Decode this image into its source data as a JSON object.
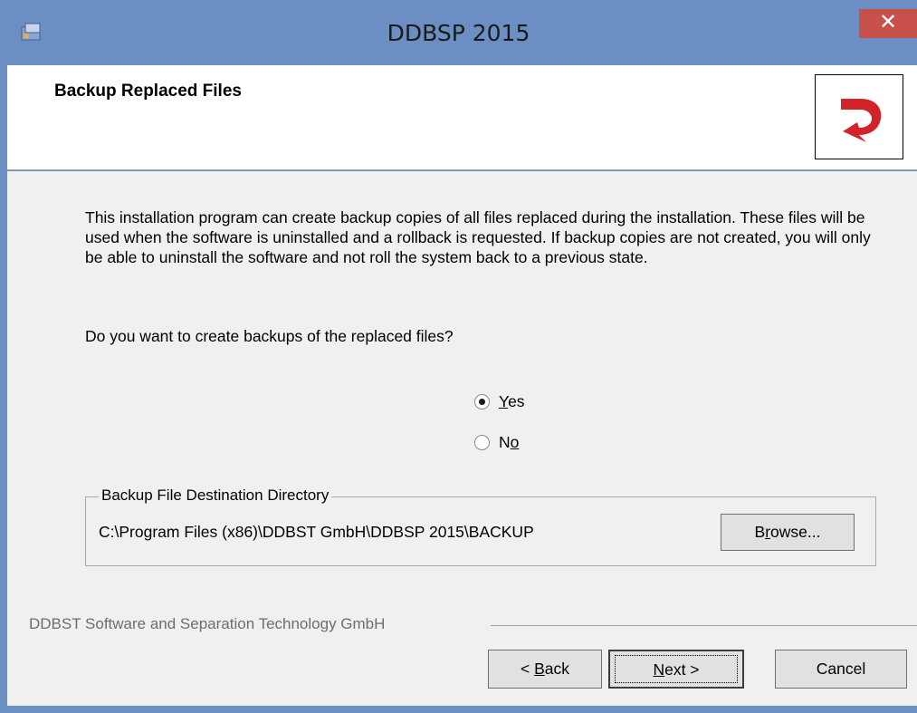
{
  "window": {
    "title": "DDBSP 2015",
    "close_label": "✕"
  },
  "header": {
    "title": "Backup Replaced Files"
  },
  "body": {
    "description": "This installation program can create backup copies of all files replaced during the installation. These files will be used when the software is uninstalled and a rollback is requested.  If backup copies are not created, you will only be able to uninstall the software and not roll the system back to a previous state.",
    "question": "Do you want to create backups of the replaced files?",
    "options": [
      {
        "label_pre": "",
        "label_u": "Y",
        "label_post": "es",
        "selected": true
      },
      {
        "label_pre": "N",
        "label_u": "o",
        "label_post": "",
        "selected": false
      }
    ],
    "group": {
      "legend": "Backup File Destination Directory",
      "path": "C:\\Program Files (x86)\\DDBST GmbH\\DDBSP 2015\\BACKUP",
      "browse_pre": "B",
      "browse_u": "r",
      "browse_post": "owse..."
    }
  },
  "footer": {
    "vendor": "DDBST Software and Separation Technology GmbH",
    "back_pre": "< ",
    "back_u": "B",
    "back_post": "ack",
    "next_u": "N",
    "next_post": "ext >",
    "cancel": "Cancel"
  },
  "colors": {
    "titlebar": "#6b8fc3",
    "close": "#c7514a",
    "logo_red": "#d2232a"
  }
}
